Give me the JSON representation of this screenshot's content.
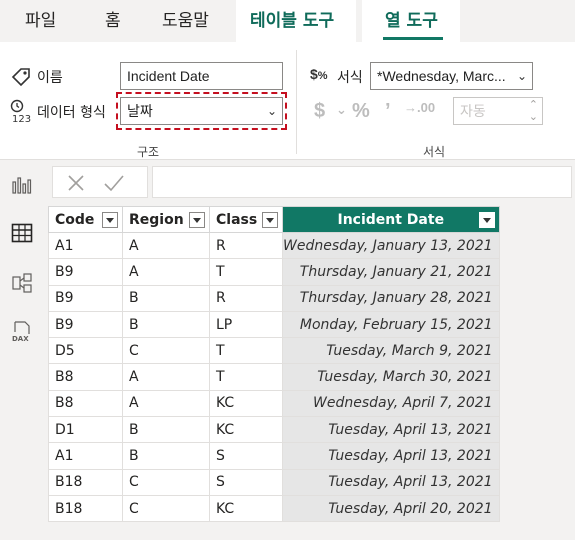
{
  "tabs": [
    {
      "label": "파일",
      "bold": false
    },
    {
      "label": "홈",
      "bold": false
    },
    {
      "label": "도움말",
      "bold": false
    },
    {
      "label": "테이블 도구",
      "bold": true
    },
    {
      "label": "열 도구",
      "bold": true
    }
  ],
  "ribbon": {
    "name_label": "이름",
    "name_value": "Incident Date",
    "datatype_label": "데이터 형식",
    "datatype_value": "날짜",
    "structure_group": "구조",
    "format_label": "서식",
    "format_value": "*Wednesday, Marc...",
    "decimal_value": "자동",
    "format_group": "서식"
  },
  "table": {
    "columns": [
      "Code",
      "Region",
      "Class",
      "Incident Date"
    ],
    "selected_column": "Incident Date",
    "rows": [
      [
        "A1",
        "A",
        "R",
        "Wednesday, January 13, 2021"
      ],
      [
        "B9",
        "A",
        "T",
        "Thursday, January 21, 2021"
      ],
      [
        "B9",
        "B",
        "R",
        "Thursday, January 28, 2021"
      ],
      [
        "B9",
        "B",
        "LP",
        "Monday, February 15, 2021"
      ],
      [
        "D5",
        "C",
        "T",
        "Tuesday, March 9, 2021"
      ],
      [
        "B8",
        "A",
        "T",
        "Tuesday, March 30, 2021"
      ],
      [
        "B8",
        "A",
        "KC",
        "Wednesday, April 7, 2021"
      ],
      [
        "D1",
        "B",
        "KC",
        "Tuesday, April 13, 2021"
      ],
      [
        "A1",
        "B",
        "S",
        "Tuesday, April 13, 2021"
      ],
      [
        "B18",
        "C",
        "S",
        "Tuesday, April 13, 2021"
      ],
      [
        "B18",
        "C",
        "KC",
        "Tuesday, April 20, 2021"
      ]
    ]
  },
  "colors": {
    "accent": "#117865",
    "focus": "#c50f1f",
    "selected_cells": "#e6e6e6"
  }
}
